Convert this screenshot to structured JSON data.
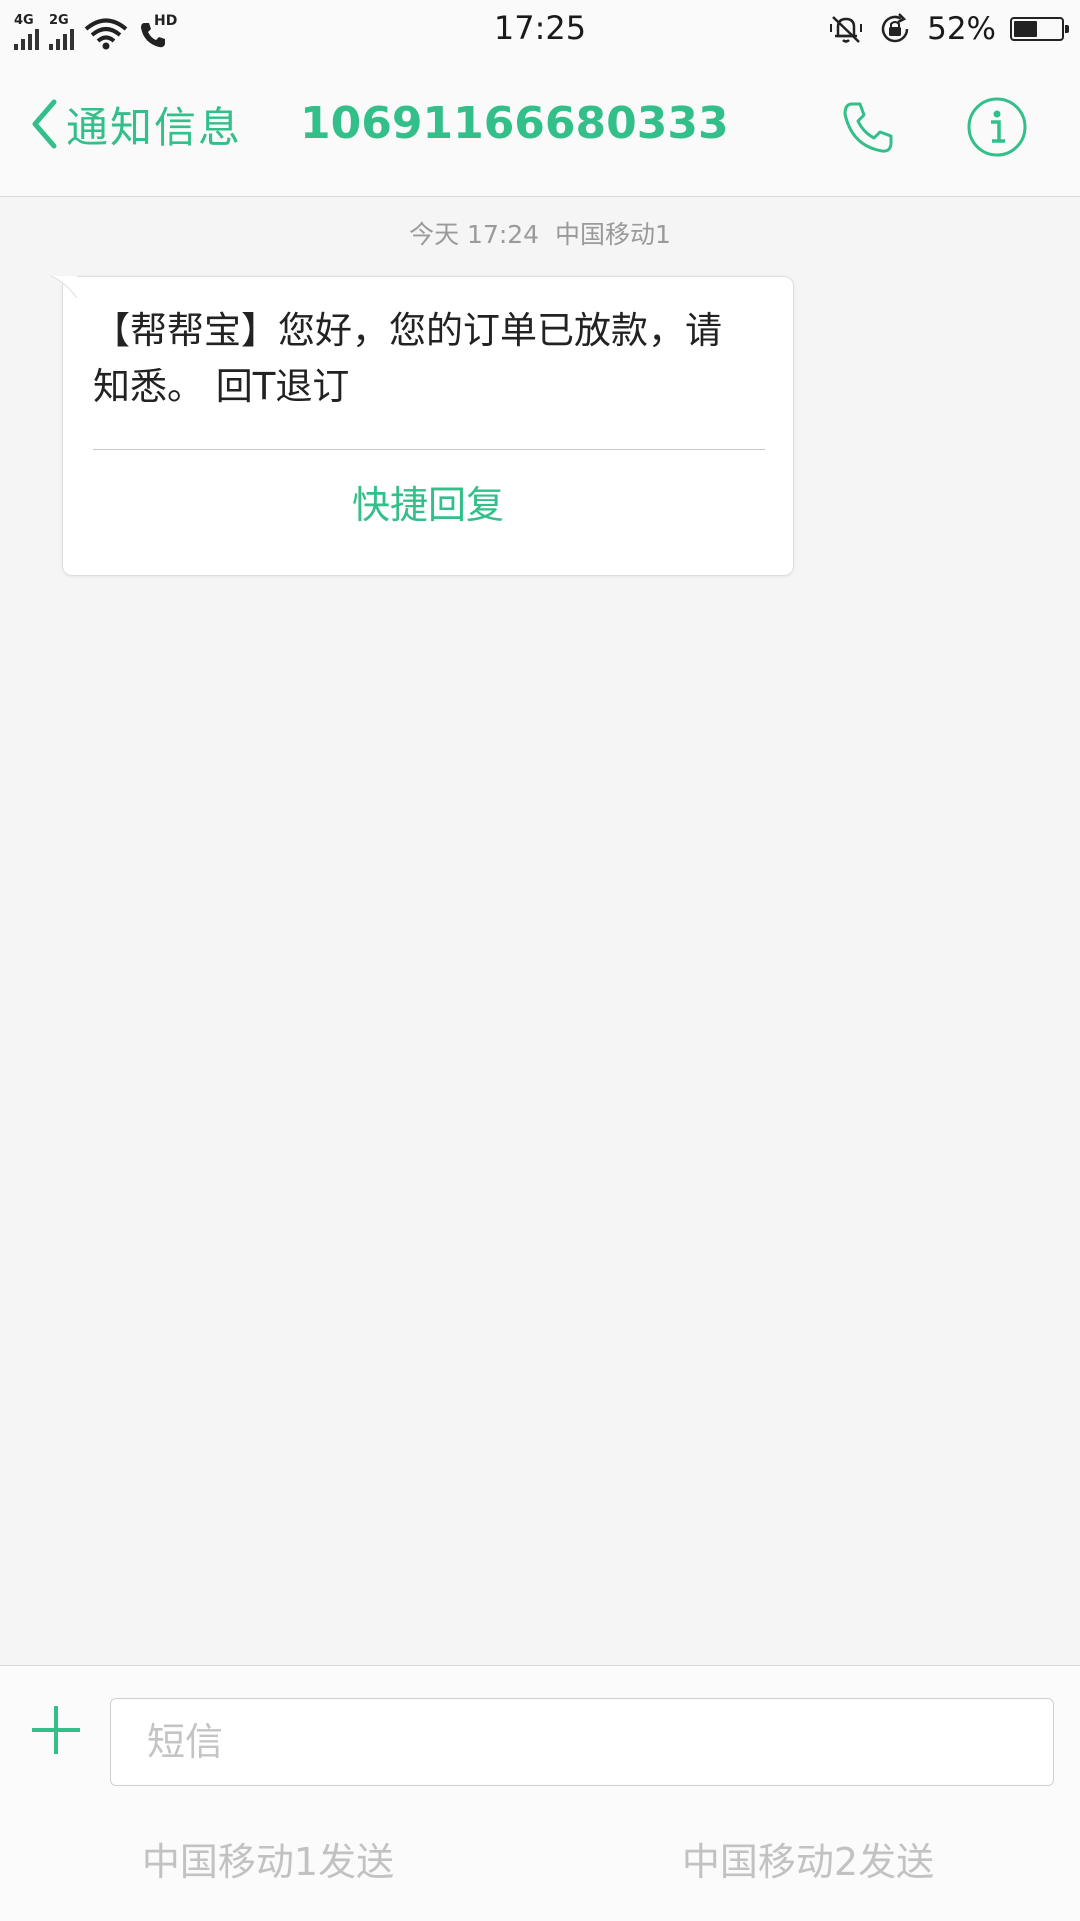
{
  "status_bar": {
    "sim1_network": "4G",
    "sim2_network": "2G",
    "hd_label": "HD",
    "time": "17:25",
    "battery_percent": "52%",
    "battery_level": 0.52,
    "icons": [
      "signal-icon",
      "wifi-icon",
      "hd-call-icon",
      "silent-bell-icon",
      "rotation-lock-icon",
      "battery-icon"
    ]
  },
  "header": {
    "back_label": "通知信息",
    "title": "10691166680333",
    "call_icon": "phone-icon",
    "info_icon": "info-icon"
  },
  "conversation": {
    "messages": [
      {
        "meta": "今天 17:24  中国移动1",
        "text": "【帮帮宝】您好，您的订单已放款，请知悉。 回T退订",
        "quick_reply_label": "快捷回复"
      }
    ]
  },
  "compose": {
    "add_icon": "plus-icon",
    "input_placeholder": "短信",
    "input_value": "",
    "send_sim1_label": "中国移动1发送",
    "send_sim2_label": "中国移动2发送"
  },
  "colors": {
    "accent": "#33bf8a",
    "background": "#f5f5f5",
    "disabled_text": "#c2c2c2"
  }
}
